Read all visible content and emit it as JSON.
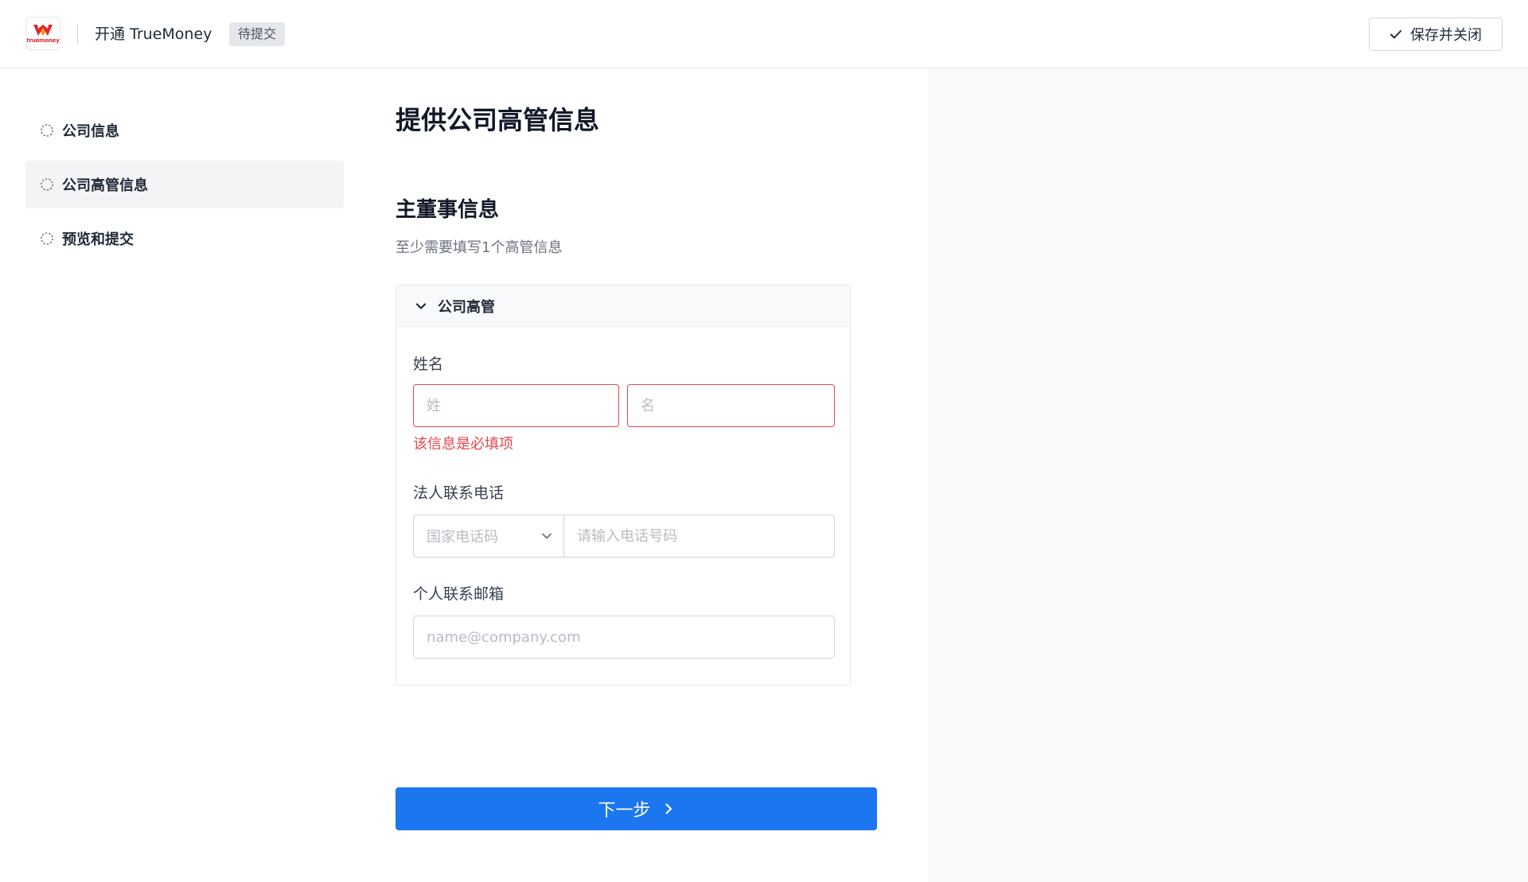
{
  "header": {
    "logo_text": "truemoney",
    "title": "开通 TrueMoney",
    "status_badge": "待提交",
    "save_close_label": "保存并关闭"
  },
  "sidebar": {
    "steps": [
      {
        "label": "公司信息",
        "active": false
      },
      {
        "label": "公司高管信息",
        "active": true
      },
      {
        "label": "预览和提交",
        "active": false
      }
    ]
  },
  "main": {
    "page_title": "提供公司高管信息",
    "section_title": "主董事信息",
    "section_subtitle": "至少需要填写1个高管信息",
    "card": {
      "title": "公司高管",
      "name_label": "姓名",
      "surname_placeholder": "姓",
      "given_name_placeholder": "名",
      "name_error": "该信息是必填项",
      "phone_label": "法人联系电话",
      "country_code_placeholder": "国家电话码",
      "phone_placeholder": "请输入电话号码",
      "email_label": "个人联系邮箱",
      "email_placeholder": "name@company.com"
    },
    "next_label": "下一步"
  },
  "colors": {
    "primary": "#1b76f0",
    "error": "#e5484d",
    "brand_red": "#e4262b",
    "brand_orange": "#f7941d"
  }
}
